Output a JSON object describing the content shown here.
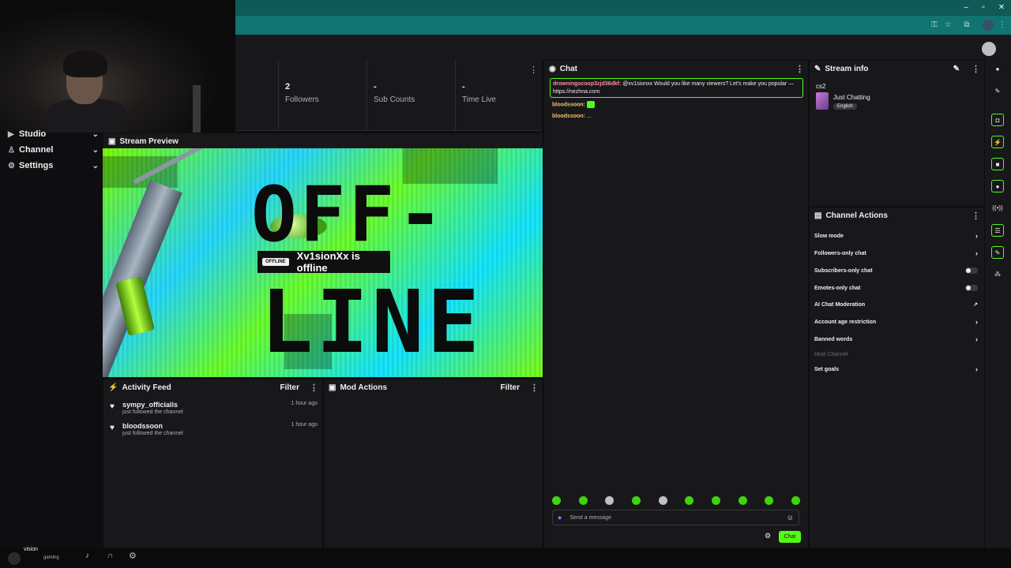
{
  "stats": {
    "followers": {
      "value": "2",
      "label": "Followers"
    },
    "subs": {
      "value": "-",
      "label": "Sub Counts"
    },
    "time_live": {
      "value": "-",
      "label": "Time Live"
    }
  },
  "sidebar": {
    "items": [
      {
        "label": "Studio"
      },
      {
        "label": "Channel"
      },
      {
        "label": "Settings"
      }
    ]
  },
  "stream_preview": {
    "title": "Stream Preview",
    "badge": "OFFLINE",
    "status_text": "Xv1sionXx is offline",
    "art_text_top": "OFF-",
    "art_text_bottom": "LINE"
  },
  "activity_feed": {
    "title": "Activity Feed",
    "filter_label": "Filter",
    "items": [
      {
        "name": "sympy_officialis",
        "desc": "just followed the channel",
        "time": "1 hour ago"
      },
      {
        "name": "bloodssoon",
        "desc": "just followed the channel",
        "time": "1 hour ago"
      }
    ]
  },
  "mod_actions": {
    "title": "Mod Actions",
    "filter_label": "Filter"
  },
  "chat": {
    "title": "Chat",
    "messages": [
      {
        "user": "drowningscoop3zjd36dkf:",
        "text": "@xv1sionxx Would you like many viewers? Let's make you popular —",
        "link": "https://nezhna.com"
      },
      {
        "user": "bloodssoon:",
        "text": ""
      },
      {
        "user": "bloodssoon:",
        "text": "..."
      }
    ],
    "input_placeholder": "Send a message",
    "send_label": "Chat"
  },
  "stream_info": {
    "title": "Stream info",
    "stream_title": "cs2",
    "category": "Just Chatting",
    "language": "English"
  },
  "channel_actions": {
    "title": "Channel Actions",
    "items": [
      {
        "label": "Slow mode",
        "control": "chevron"
      },
      {
        "label": "Followers-only chat",
        "control": "chevron"
      },
      {
        "label": "Subscribers-only chat",
        "control": "toggle"
      },
      {
        "label": "Emotes-only chat",
        "control": "toggle"
      },
      {
        "label": "AI Chat Moderation",
        "control": "external"
      },
      {
        "label": "Account age restriction",
        "control": "chevron"
      },
      {
        "label": "Banned words",
        "control": "chevron"
      },
      {
        "label": "Host Channel",
        "control": "none"
      },
      {
        "label": "Set goals",
        "control": "chevron"
      }
    ]
  },
  "bottom": {
    "username": "vision",
    "status": "gaming"
  },
  "colors": {
    "accent": "#53fc18",
    "panel_bg": "#18181b",
    "page_bg": "#0e0e10",
    "browser_bar": "#117470"
  }
}
